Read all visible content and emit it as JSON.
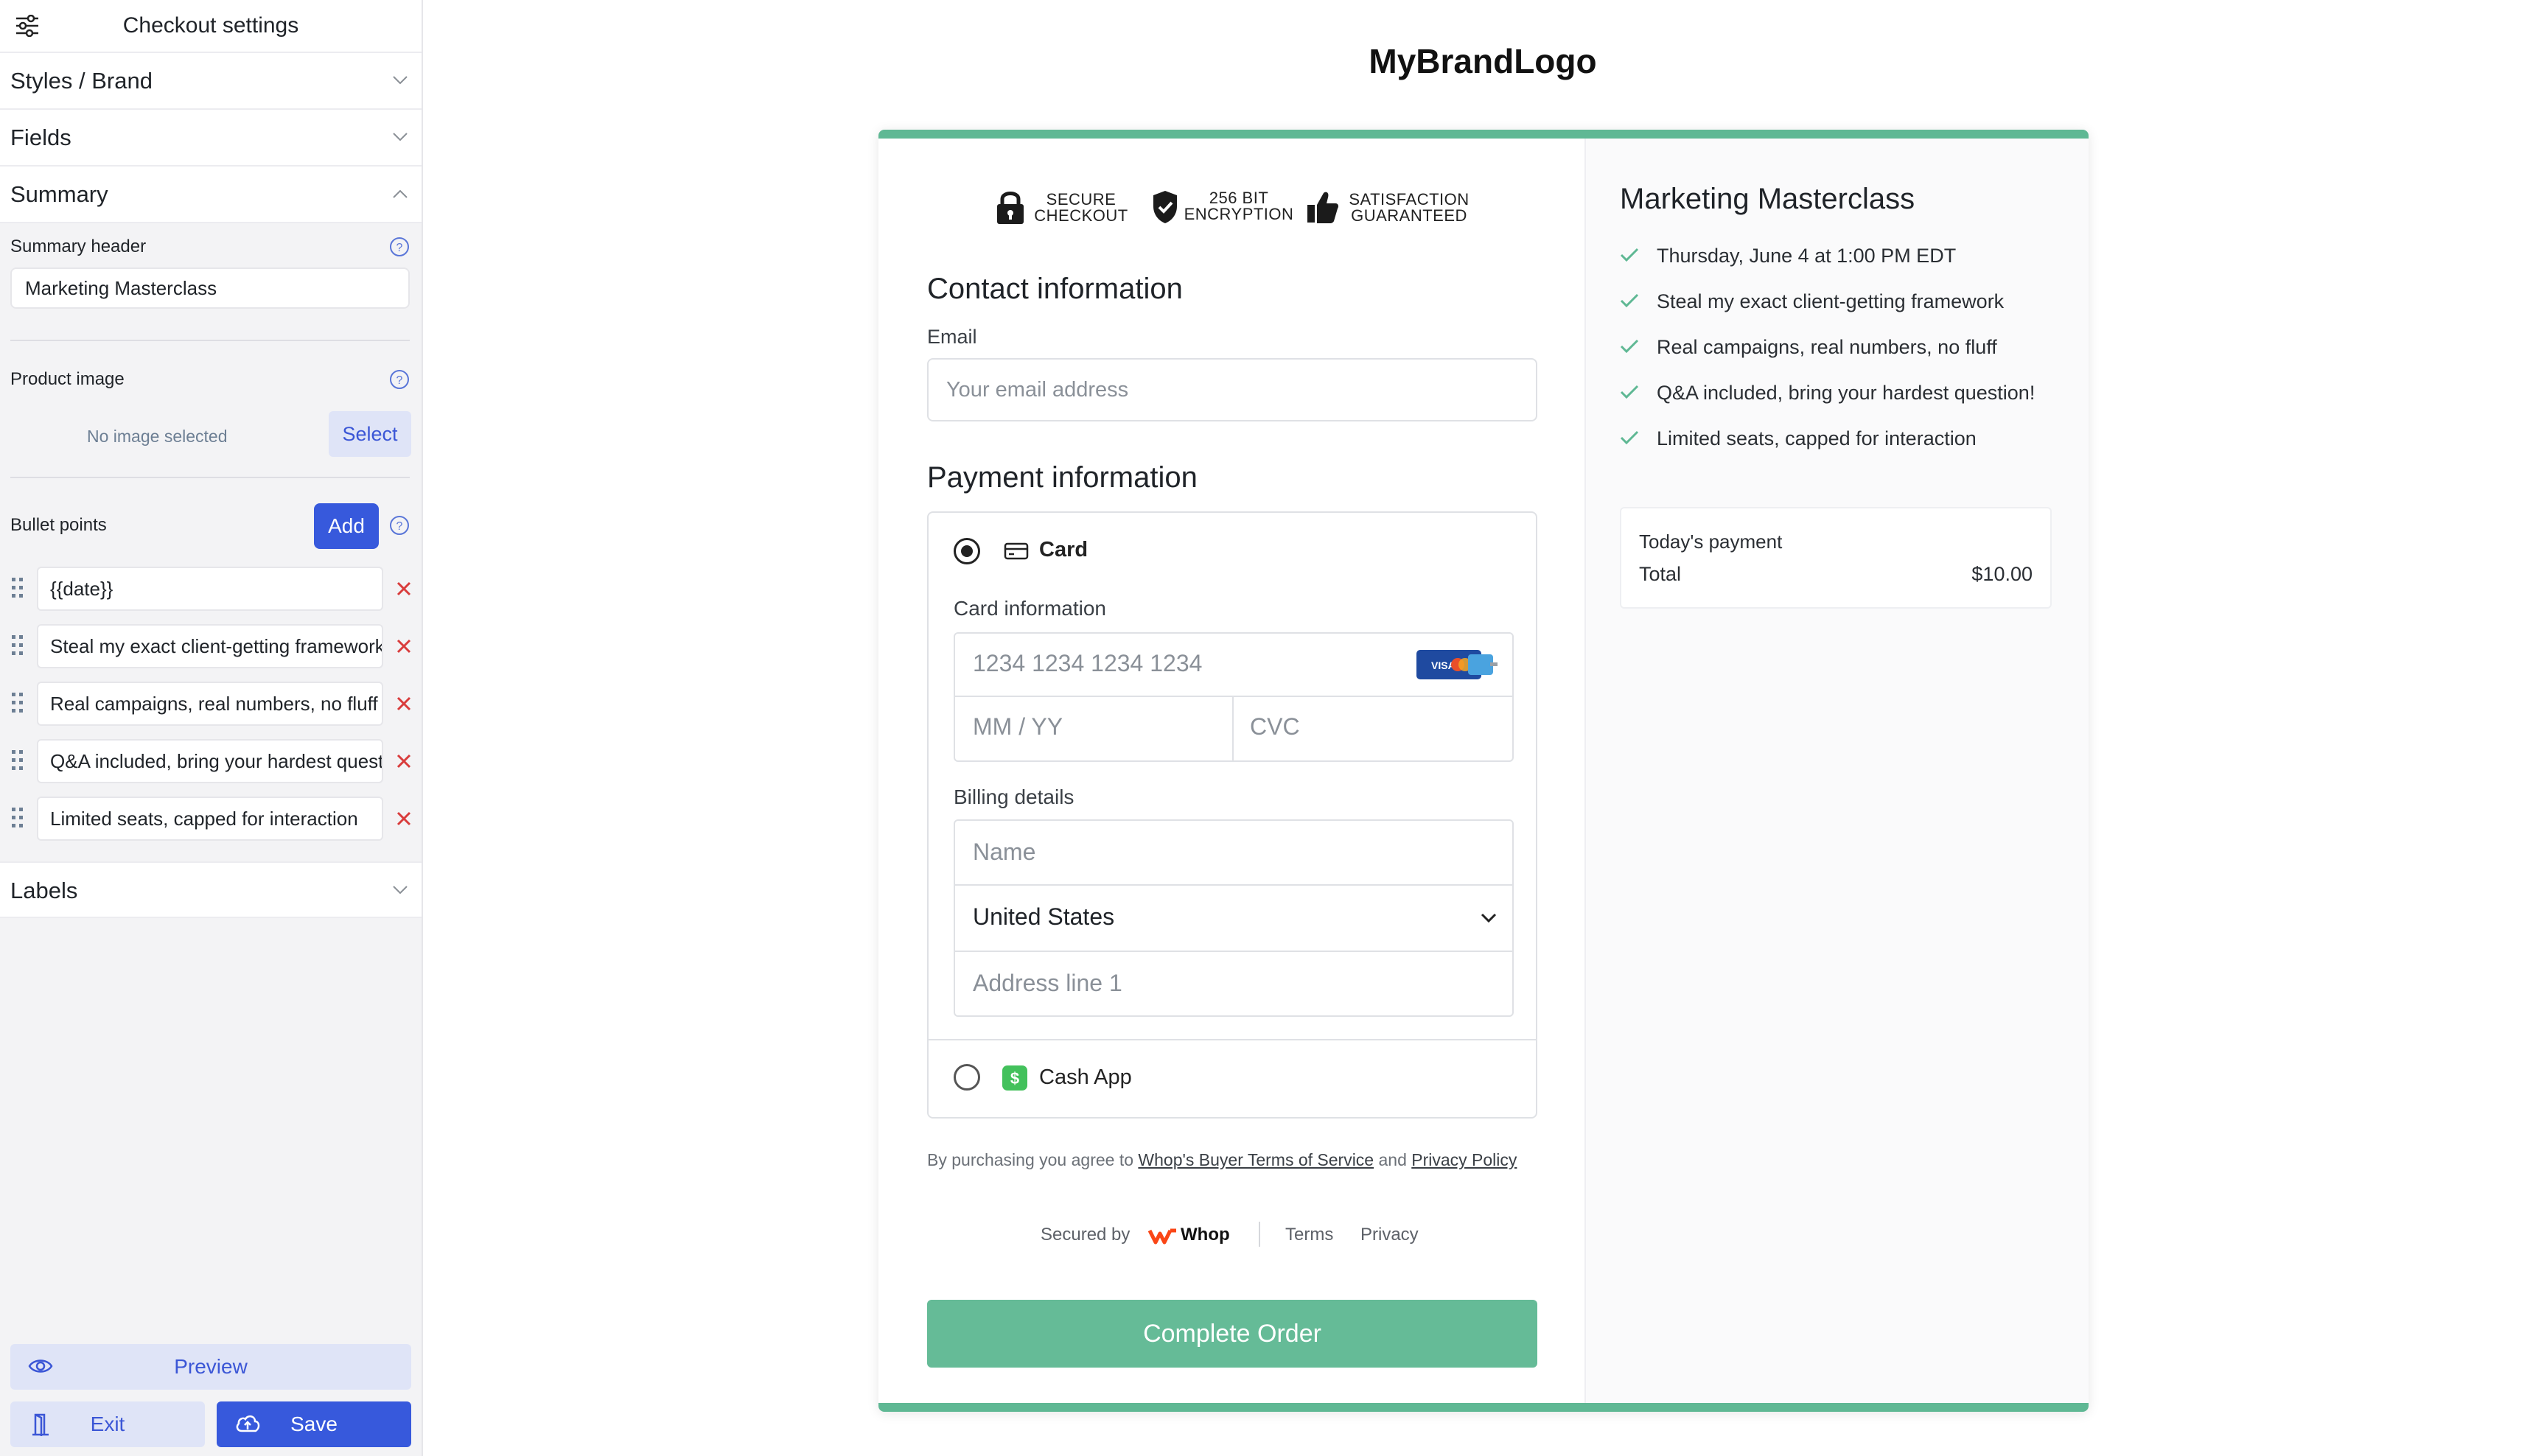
{
  "sidebar": {
    "title": "Checkout settings",
    "sections": {
      "styles": "Styles / Brand",
      "fields": "Fields",
      "summary": "Summary",
      "labels": "Labels"
    },
    "summary_header": {
      "label": "Summary header",
      "value": "Marketing Masterclass"
    },
    "product_image": {
      "label": "Product image",
      "empty_text": "No image selected",
      "select_label": "Select"
    },
    "bullets": {
      "label": "Bullet points",
      "add_label": "Add",
      "items": [
        "{{date}}",
        "Steal my exact client-getting framework",
        "Real campaigns, real numbers, no fluff",
        "Q&A included, bring your hardest question!",
        "Limited seats, capped for interaction"
      ]
    },
    "footer": {
      "preview": "Preview",
      "exit": "Exit",
      "save": "Save"
    }
  },
  "preview": {
    "brand": "MyBrandLogo",
    "trust": {
      "secure_line1": "SECURE",
      "secure_line2": "CHECKOUT",
      "enc_line1": "256 BIT",
      "enc_line2": "ENCRYPTION",
      "sat_line1": "SATISFACTION",
      "sat_line2": "GUARANTEED"
    },
    "contact": {
      "title": "Contact information",
      "email_label": "Email",
      "email_placeholder": "Your email address"
    },
    "payment": {
      "title": "Payment information",
      "card_label": "Card",
      "card_info_label": "Card information",
      "card_number_placeholder": "1234 1234 1234 1234",
      "expiry_placeholder": "MM / YY",
      "cvc_placeholder": "CVC",
      "billing_label": "Billing details",
      "name_placeholder": "Name",
      "country_value": "United States",
      "address_placeholder": "Address line 1",
      "cashapp_label": "Cash App"
    },
    "agreement": {
      "prefix": "By purchasing you agree to ",
      "terms_link": "Whop's Buyer Terms of Service",
      "middle": " and ",
      "privacy_link": "Privacy Policy"
    },
    "footer": {
      "secured_by": "Secured by",
      "whop": "Whop",
      "terms": "Terms",
      "privacy": "Privacy"
    },
    "complete_label": "Complete Order",
    "summary": {
      "title": "Marketing Masterclass",
      "items": [
        "Thursday, June 4 at 1:00 PM EDT",
        "Steal my exact client-getting framework",
        "Real campaigns, real numbers, no fluff",
        "Q&A included, bring your hardest question!",
        "Limited seats, capped for interaction"
      ],
      "todays_payment": "Today's payment",
      "total_label": "Total",
      "total_value": "$10.00"
    }
  },
  "colors": {
    "accent_blue": "#3759dc",
    "accent_green": "#5fb894",
    "error_red": "#d93c3c"
  }
}
